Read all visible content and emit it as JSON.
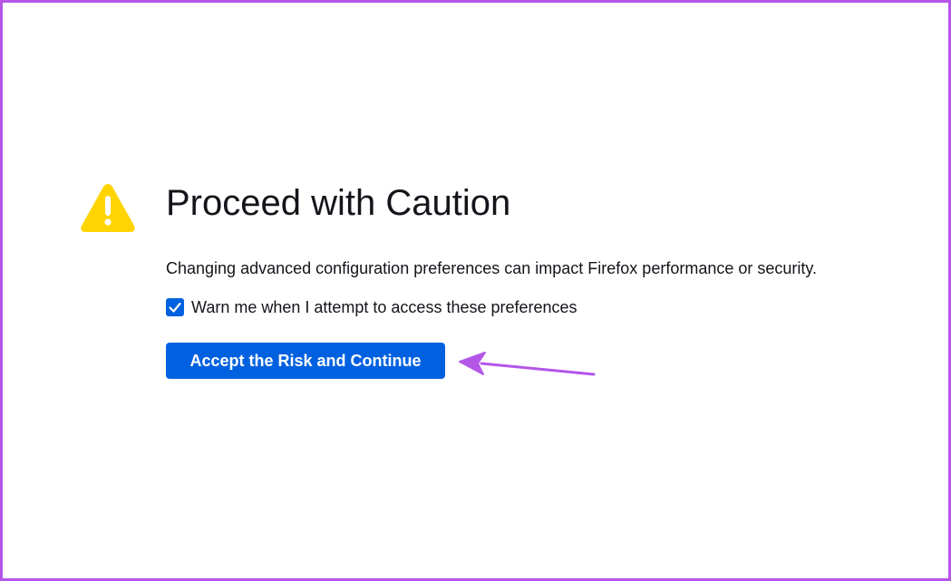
{
  "page": {
    "title": "Proceed with Caution",
    "description": "Changing advanced configuration preferences can impact Firefox performance or security.",
    "warn_checkbox": {
      "label": "Warn me when I attempt to access these preferences",
      "checked": true
    },
    "accept_button_label": "Accept the Risk and Continue",
    "icon": "warning-icon"
  },
  "colors": {
    "accent": "#0061e0",
    "warning": "#ffd400",
    "annotation": "#b456e8",
    "text": "#15141a"
  }
}
